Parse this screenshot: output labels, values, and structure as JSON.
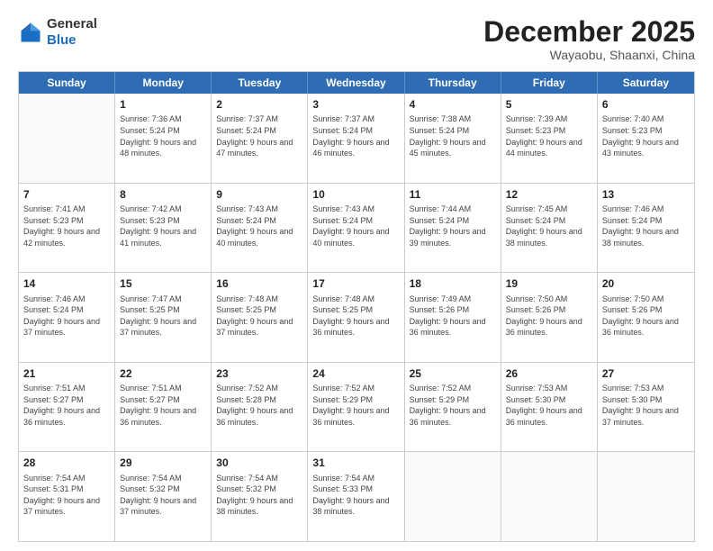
{
  "logo": {
    "general": "General",
    "blue": "Blue"
  },
  "header": {
    "month": "December 2025",
    "location": "Wayaobu, Shaanxi, China"
  },
  "days": [
    "Sunday",
    "Monday",
    "Tuesday",
    "Wednesday",
    "Thursday",
    "Friday",
    "Saturday"
  ],
  "weeks": [
    [
      {
        "day": "",
        "sunrise": "",
        "sunset": "",
        "daylight": ""
      },
      {
        "day": "1",
        "sunrise": "Sunrise: 7:36 AM",
        "sunset": "Sunset: 5:24 PM",
        "daylight": "Daylight: 9 hours and 48 minutes."
      },
      {
        "day": "2",
        "sunrise": "Sunrise: 7:37 AM",
        "sunset": "Sunset: 5:24 PM",
        "daylight": "Daylight: 9 hours and 47 minutes."
      },
      {
        "day": "3",
        "sunrise": "Sunrise: 7:37 AM",
        "sunset": "Sunset: 5:24 PM",
        "daylight": "Daylight: 9 hours and 46 minutes."
      },
      {
        "day": "4",
        "sunrise": "Sunrise: 7:38 AM",
        "sunset": "Sunset: 5:24 PM",
        "daylight": "Daylight: 9 hours and 45 minutes."
      },
      {
        "day": "5",
        "sunrise": "Sunrise: 7:39 AM",
        "sunset": "Sunset: 5:23 PM",
        "daylight": "Daylight: 9 hours and 44 minutes."
      },
      {
        "day": "6",
        "sunrise": "Sunrise: 7:40 AM",
        "sunset": "Sunset: 5:23 PM",
        "daylight": "Daylight: 9 hours and 43 minutes."
      }
    ],
    [
      {
        "day": "7",
        "sunrise": "Sunrise: 7:41 AM",
        "sunset": "Sunset: 5:23 PM",
        "daylight": "Daylight: 9 hours and 42 minutes."
      },
      {
        "day": "8",
        "sunrise": "Sunrise: 7:42 AM",
        "sunset": "Sunset: 5:23 PM",
        "daylight": "Daylight: 9 hours and 41 minutes."
      },
      {
        "day": "9",
        "sunrise": "Sunrise: 7:43 AM",
        "sunset": "Sunset: 5:24 PM",
        "daylight": "Daylight: 9 hours and 40 minutes."
      },
      {
        "day": "10",
        "sunrise": "Sunrise: 7:43 AM",
        "sunset": "Sunset: 5:24 PM",
        "daylight": "Daylight: 9 hours and 40 minutes."
      },
      {
        "day": "11",
        "sunrise": "Sunrise: 7:44 AM",
        "sunset": "Sunset: 5:24 PM",
        "daylight": "Daylight: 9 hours and 39 minutes."
      },
      {
        "day": "12",
        "sunrise": "Sunrise: 7:45 AM",
        "sunset": "Sunset: 5:24 PM",
        "daylight": "Daylight: 9 hours and 38 minutes."
      },
      {
        "day": "13",
        "sunrise": "Sunrise: 7:46 AM",
        "sunset": "Sunset: 5:24 PM",
        "daylight": "Daylight: 9 hours and 38 minutes."
      }
    ],
    [
      {
        "day": "14",
        "sunrise": "Sunrise: 7:46 AM",
        "sunset": "Sunset: 5:24 PM",
        "daylight": "Daylight: 9 hours and 37 minutes."
      },
      {
        "day": "15",
        "sunrise": "Sunrise: 7:47 AM",
        "sunset": "Sunset: 5:25 PM",
        "daylight": "Daylight: 9 hours and 37 minutes."
      },
      {
        "day": "16",
        "sunrise": "Sunrise: 7:48 AM",
        "sunset": "Sunset: 5:25 PM",
        "daylight": "Daylight: 9 hours and 37 minutes."
      },
      {
        "day": "17",
        "sunrise": "Sunrise: 7:48 AM",
        "sunset": "Sunset: 5:25 PM",
        "daylight": "Daylight: 9 hours and 36 minutes."
      },
      {
        "day": "18",
        "sunrise": "Sunrise: 7:49 AM",
        "sunset": "Sunset: 5:26 PM",
        "daylight": "Daylight: 9 hours and 36 minutes."
      },
      {
        "day": "19",
        "sunrise": "Sunrise: 7:50 AM",
        "sunset": "Sunset: 5:26 PM",
        "daylight": "Daylight: 9 hours and 36 minutes."
      },
      {
        "day": "20",
        "sunrise": "Sunrise: 7:50 AM",
        "sunset": "Sunset: 5:26 PM",
        "daylight": "Daylight: 9 hours and 36 minutes."
      }
    ],
    [
      {
        "day": "21",
        "sunrise": "Sunrise: 7:51 AM",
        "sunset": "Sunset: 5:27 PM",
        "daylight": "Daylight: 9 hours and 36 minutes."
      },
      {
        "day": "22",
        "sunrise": "Sunrise: 7:51 AM",
        "sunset": "Sunset: 5:27 PM",
        "daylight": "Daylight: 9 hours and 36 minutes."
      },
      {
        "day": "23",
        "sunrise": "Sunrise: 7:52 AM",
        "sunset": "Sunset: 5:28 PM",
        "daylight": "Daylight: 9 hours and 36 minutes."
      },
      {
        "day": "24",
        "sunrise": "Sunrise: 7:52 AM",
        "sunset": "Sunset: 5:29 PM",
        "daylight": "Daylight: 9 hours and 36 minutes."
      },
      {
        "day": "25",
        "sunrise": "Sunrise: 7:52 AM",
        "sunset": "Sunset: 5:29 PM",
        "daylight": "Daylight: 9 hours and 36 minutes."
      },
      {
        "day": "26",
        "sunrise": "Sunrise: 7:53 AM",
        "sunset": "Sunset: 5:30 PM",
        "daylight": "Daylight: 9 hours and 36 minutes."
      },
      {
        "day": "27",
        "sunrise": "Sunrise: 7:53 AM",
        "sunset": "Sunset: 5:30 PM",
        "daylight": "Daylight: 9 hours and 37 minutes."
      }
    ],
    [
      {
        "day": "28",
        "sunrise": "Sunrise: 7:54 AM",
        "sunset": "Sunset: 5:31 PM",
        "daylight": "Daylight: 9 hours and 37 minutes."
      },
      {
        "day": "29",
        "sunrise": "Sunrise: 7:54 AM",
        "sunset": "Sunset: 5:32 PM",
        "daylight": "Daylight: 9 hours and 37 minutes."
      },
      {
        "day": "30",
        "sunrise": "Sunrise: 7:54 AM",
        "sunset": "Sunset: 5:32 PM",
        "daylight": "Daylight: 9 hours and 38 minutes."
      },
      {
        "day": "31",
        "sunrise": "Sunrise: 7:54 AM",
        "sunset": "Sunset: 5:33 PM",
        "daylight": "Daylight: 9 hours and 38 minutes."
      },
      {
        "day": "",
        "sunrise": "",
        "sunset": "",
        "daylight": ""
      },
      {
        "day": "",
        "sunrise": "",
        "sunset": "",
        "daylight": ""
      },
      {
        "day": "",
        "sunrise": "",
        "sunset": "",
        "daylight": ""
      }
    ]
  ]
}
